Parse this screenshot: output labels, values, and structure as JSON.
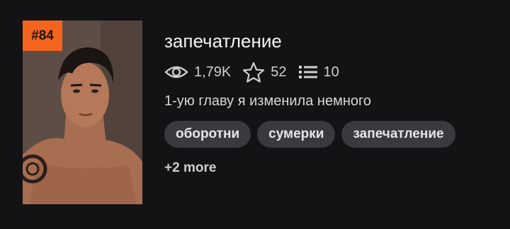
{
  "story": {
    "rank": "#84",
    "title": "запечатление",
    "stats": {
      "reads": "1,79K",
      "votes": "52",
      "parts": "10"
    },
    "description": "1-ую главу я изменила немного",
    "tags": [
      "оборотни",
      "сумерки",
      "запечатление"
    ],
    "more_tags": "+2 more",
    "cover_icon": "cover-image"
  },
  "colors": {
    "background": "#131215",
    "rank_badge": "#f5641e",
    "tag_background": "#3a393d",
    "text": "#f4f4f4"
  },
  "icons": {
    "reads": "eye-icon",
    "votes": "star-icon",
    "parts": "list-icon"
  }
}
